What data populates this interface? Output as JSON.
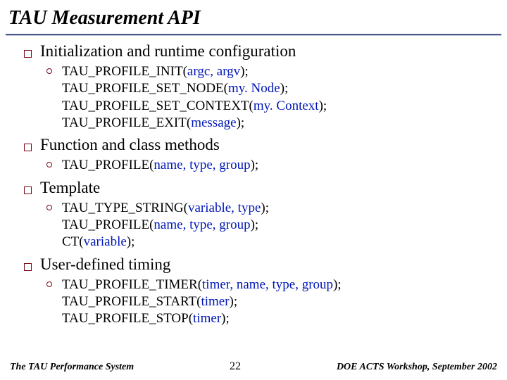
{
  "title": "TAU Measurement API",
  "sections": {
    "s0": {
      "heading": "Initialization and runtime configuration",
      "lines": {
        "l0": {
          "pre": "TAU_PROFILE_INIT(",
          "args": "argc, argv",
          "post": ");"
        },
        "l1": {
          "pre": "TAU_PROFILE_SET_NODE(",
          "args": "my. Node",
          "post": ");"
        },
        "l2": {
          "pre": "TAU_PROFILE_SET_CONTEXT(",
          "args": "my. Context",
          "post": ");"
        },
        "l3": {
          "pre": "TAU_PROFILE_EXIT(",
          "args": "message",
          "post": ");"
        }
      }
    },
    "s1": {
      "heading": "Function and class methods",
      "lines": {
        "l0": {
          "pre": "TAU_PROFILE(",
          "args": "name, type, group",
          "post": ");"
        }
      }
    },
    "s2": {
      "heading": "Template",
      "lines": {
        "l0": {
          "pre": "TAU_TYPE_STRING(",
          "args": "variable, type",
          "post": ");"
        },
        "l1": {
          "pre": "TAU_PROFILE(",
          "args": "name, type, group",
          "post": ");"
        },
        "l2": {
          "pre": "CT(",
          "args": "variable",
          "post": ");"
        }
      }
    },
    "s3": {
      "heading": "User-defined timing",
      "lines": {
        "l0": {
          "pre": "TAU_PROFILE_TIMER(",
          "args": "timer, name, type, group",
          "post": ");"
        },
        "l1": {
          "pre": "TAU_PROFILE_START(",
          "args": "timer",
          "post": ");"
        },
        "l2": {
          "pre": "TAU_PROFILE_STOP(",
          "args": "timer",
          "post": ");"
        }
      }
    }
  },
  "footer": {
    "left": "The TAU Performance System",
    "center": "22",
    "right": "DOE ACTS Workshop, September 2002"
  }
}
